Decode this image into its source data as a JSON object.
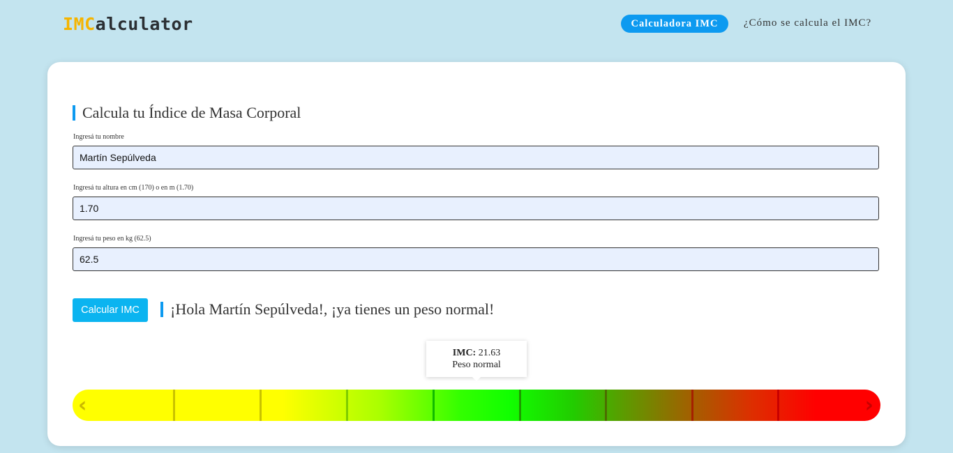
{
  "header": {
    "logo_part1": "IMC",
    "logo_part2": "alculator",
    "nav_button": "Calculadora IMC",
    "nav_link": "¿Cómo se calcula el IMC?"
  },
  "form": {
    "title": "Calcula tu Índice de Masa Corporal",
    "name_label": "Ingresá tu nombre",
    "name_value": "Martín Sepúlveda",
    "height_label": "Ingresá tu altura en cm (170) o en m (1.70)",
    "height_value": "1.70",
    "weight_label": "Ingresá tu peso en kg (62.5)",
    "weight_value": "62.5",
    "button": "Calcular IMC"
  },
  "result": {
    "message": "¡Hola Martín Sepúlveda!, ¡ya tienes un peso normal!",
    "imc_label": "IMC:",
    "imc_value": "21.63",
    "category": "Peso normal"
  },
  "scale": {
    "left_arrow_icon": "chevron-left-icon",
    "right_arrow_icon": "chevron-right-icon",
    "tick_count": 8,
    "colors": {
      "low": "#ffff00",
      "mid": "#11ff00",
      "high": "#ff0000"
    }
  },
  "colors": {
    "accent": "#0d9af0",
    "button": "#0bb4f0",
    "background": "#c3e4ef",
    "logo_accent": "#f5b400"
  }
}
